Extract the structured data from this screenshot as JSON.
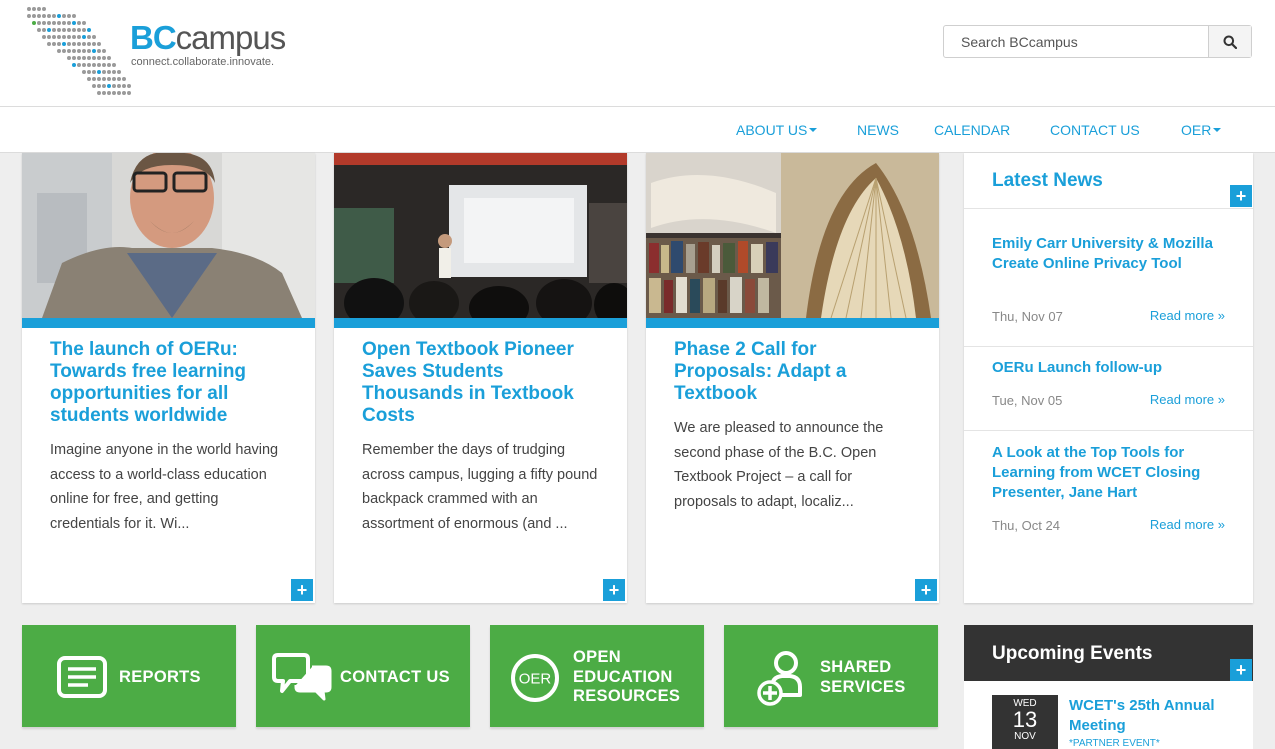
{
  "brand": {
    "name_bc": "BC",
    "name_rest": "campus",
    "tagline": "connect.collaborate.innovate.",
    "accent_color": "#1a9fd9",
    "green_color": "#4cac45"
  },
  "search": {
    "placeholder": "Search BCcampus",
    "icon": "search-icon"
  },
  "nav": {
    "items": [
      {
        "label": "ABOUT US",
        "dropdown": true
      },
      {
        "label": "NEWS"
      },
      {
        "label": "CALENDAR"
      },
      {
        "label": "CONTACT US"
      },
      {
        "label": "OER",
        "dropdown": true
      }
    ]
  },
  "cards": [
    {
      "title": "The launch of OERu: Towards free learning opportunities for all students worldwide",
      "excerpt": "Imagine anyone in the world having access to a world-class education online for free, and getting credentials for it. Wi...",
      "image": "portrait of smiling man with glasses"
    },
    {
      "title": "Open Textbook Pioneer Saves Students Thousands in Textbook Costs",
      "excerpt": "Remember the days of trudging across campus, lugging a fifty pound backpack crammed with an assortment of enormous (and ...",
      "image": "lecture hall presentation"
    },
    {
      "title": "Phase 2 Call for Proposals: Adapt a Textbook",
      "excerpt": "We are pleased to announce the second phase of the B.C. Open Textbook Project – a call for proposals to adapt, localiz...",
      "image": "open books and bookshelves"
    }
  ],
  "news": {
    "title": "Latest News",
    "items": [
      {
        "title": "Emily Carr University & Mozilla Create Online Privacy Tool",
        "date": "Thu, Nov 07",
        "more": "Read more »"
      },
      {
        "title": "OERu Launch follow-up",
        "date": "Tue, Nov 05",
        "more": "Read more »"
      },
      {
        "title": "A Look at the Top Tools for Learning from WCET Closing Presenter, Jane Hart",
        "date": "Thu, Oct 24",
        "more": "Read more »"
      }
    ]
  },
  "tiles": [
    {
      "label_lines": [
        "REPORTS"
      ],
      "icon": "document-icon"
    },
    {
      "label_lines": [
        "CONTACT US"
      ],
      "icon": "chat-bubbles-icon"
    },
    {
      "label_lines": [
        "OPEN",
        "EDUCATION",
        "RESOURCES"
      ],
      "icon": "oer-circle-icon",
      "icon_text": "OER"
    },
    {
      "label_lines": [
        "SHARED",
        "SERVICES"
      ],
      "icon": "user-add-icon"
    }
  ],
  "events": {
    "title": "Upcoming Events",
    "items": [
      {
        "weekday": "WED",
        "day": "13",
        "month": "NOV",
        "title": "WCET's 25th Annual Meeting",
        "tag": "*PARTNER EVENT*"
      }
    ]
  }
}
